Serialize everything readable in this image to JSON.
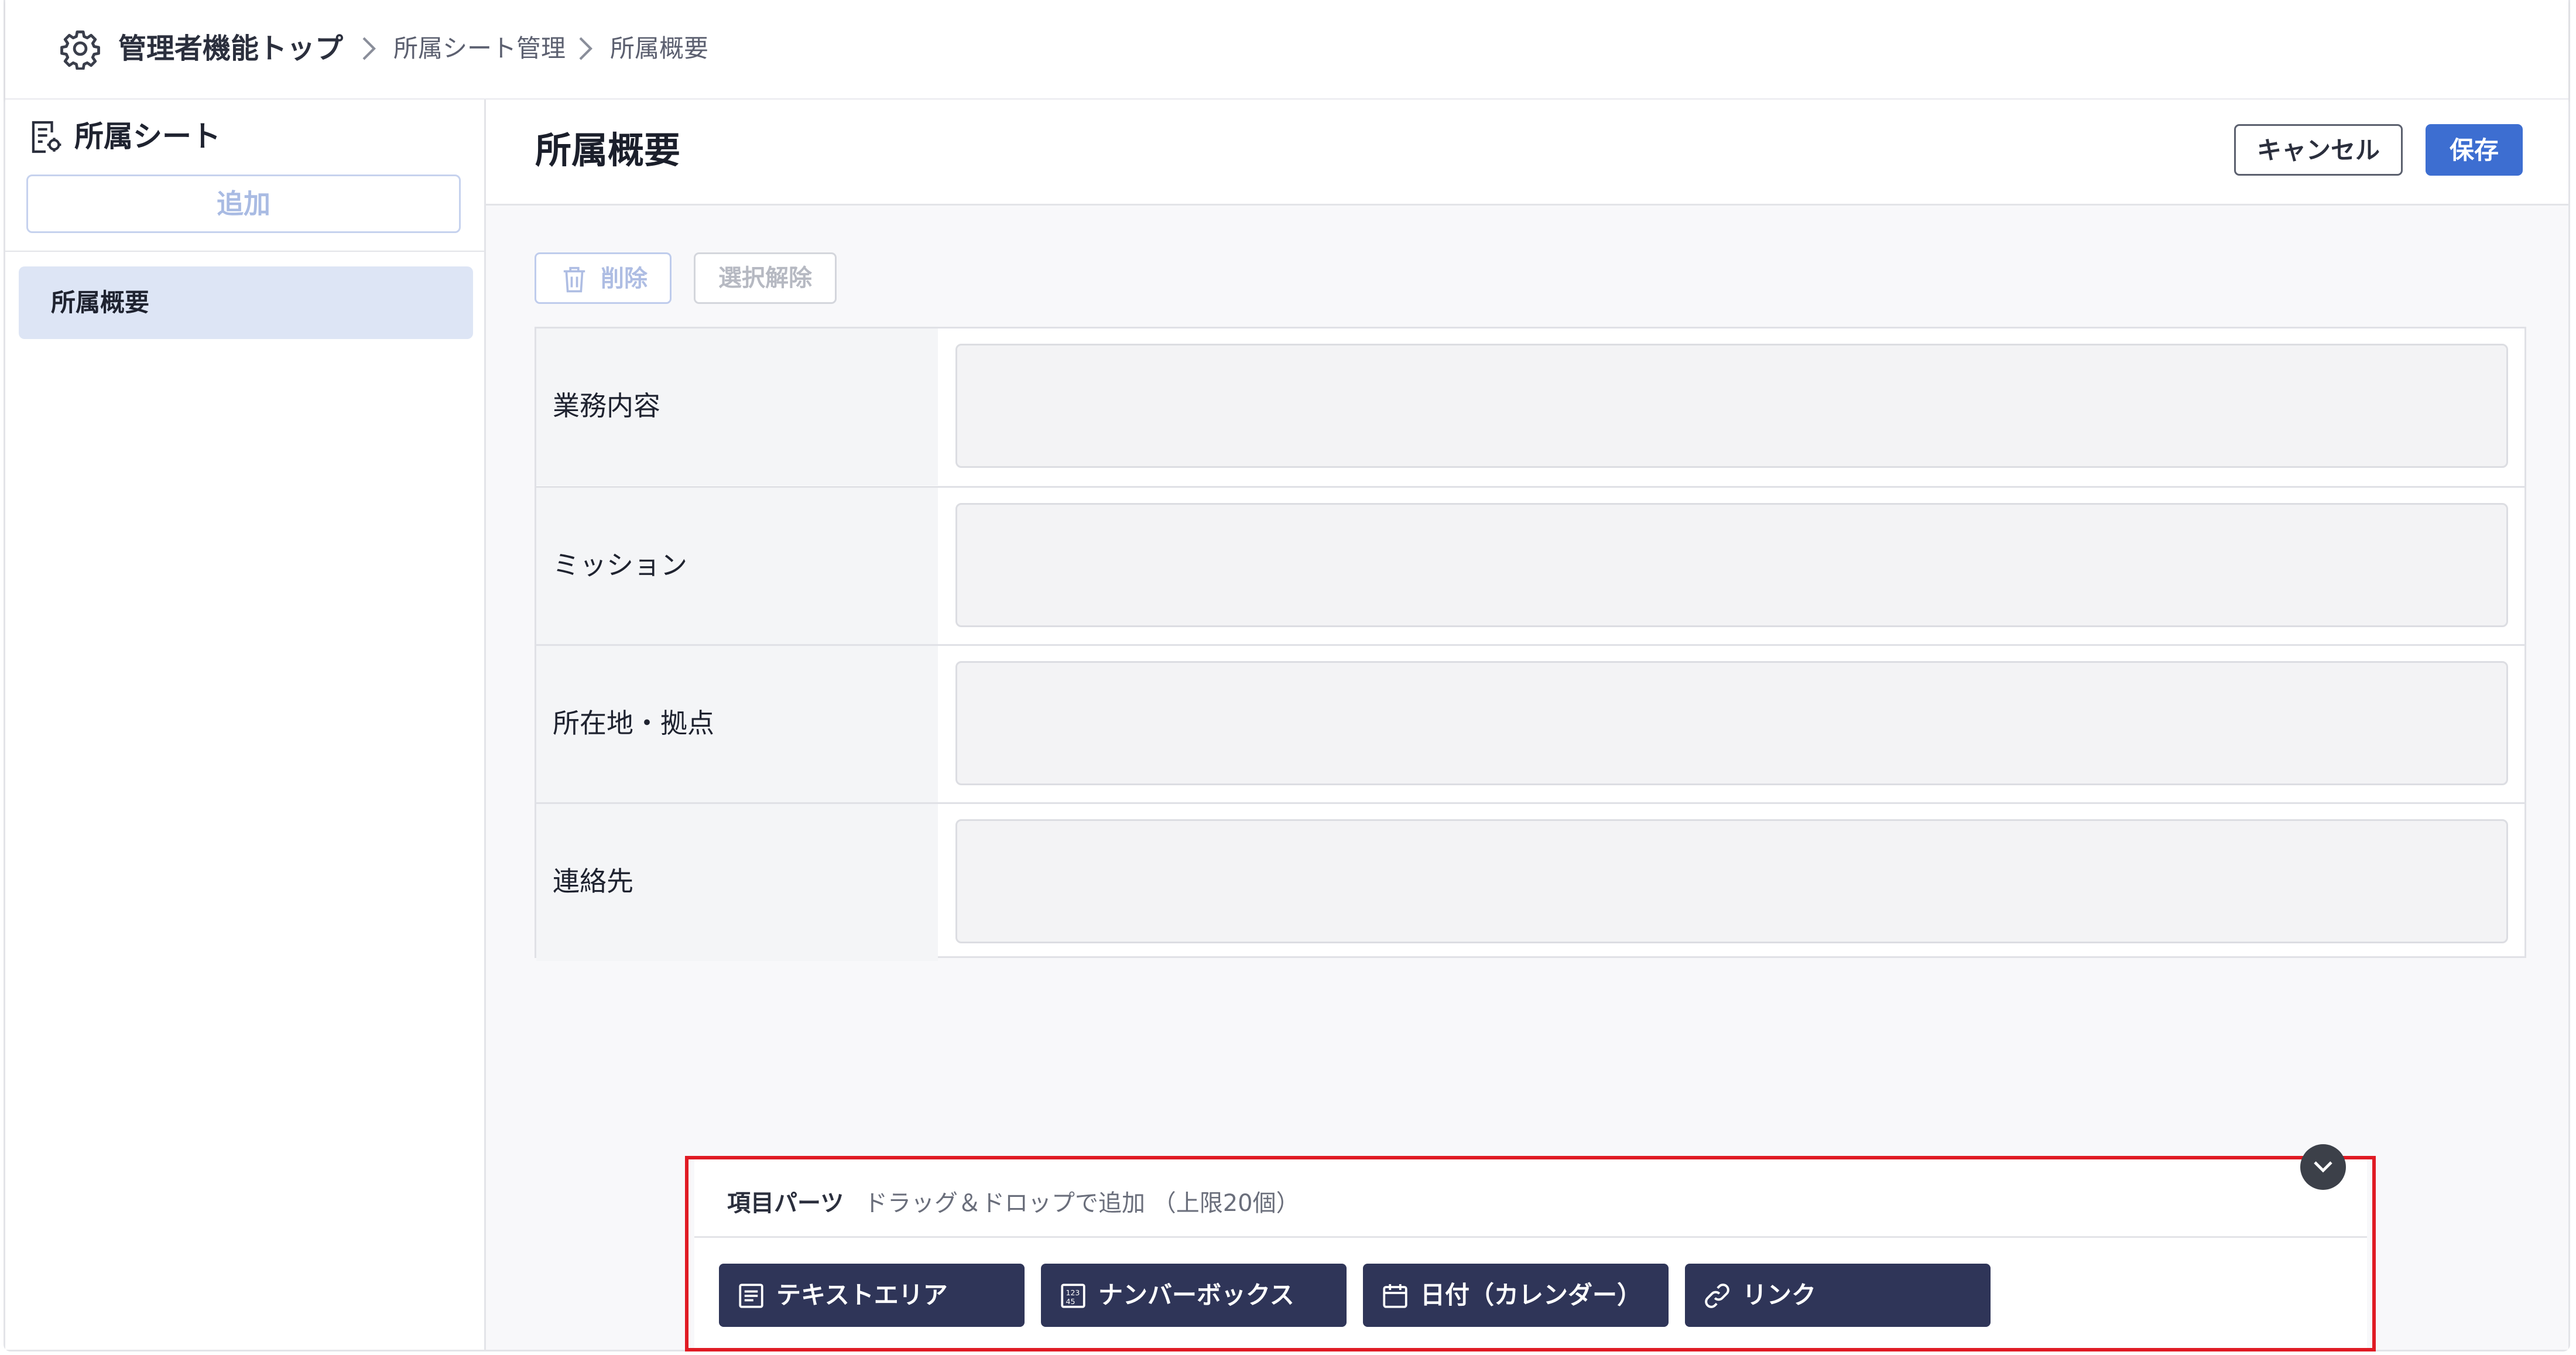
{
  "breadcrumb": {
    "root": "管理者機能トップ",
    "level2": "所属シート管理",
    "current": "所属概要"
  },
  "sidebar": {
    "title": "所属シート",
    "add_label": "追加",
    "items": [
      {
        "label": "所属概要",
        "selected": true
      }
    ]
  },
  "main": {
    "title": "所属概要",
    "cancel_label": "キャンセル",
    "save_label": "保存",
    "delete_label": "削除",
    "deselect_label": "選択解除",
    "fields": [
      {
        "label": "業務内容",
        "value": ""
      },
      {
        "label": "ミッション",
        "value": ""
      },
      {
        "label": "所在地・拠点",
        "value": ""
      },
      {
        "label": "連絡先",
        "value": ""
      }
    ]
  },
  "palette": {
    "title": "項目パーツ",
    "hint": "ドラッグ＆ドロップで追加 （上限20個）",
    "parts": [
      {
        "label": "テキストエリア",
        "icon": "text-area-icon"
      },
      {
        "label": "ナンバーボックス",
        "icon": "number-box-icon"
      },
      {
        "label": "日付（カレンダー）",
        "icon": "calendar-icon"
      },
      {
        "label": "リンク",
        "icon": "link-icon"
      }
    ]
  },
  "colors": {
    "accent": "#3d6ed1",
    "selected_item_bg": "#dde5f5",
    "part_bg": "#2f3558",
    "highlight_border": "#e01b24"
  }
}
